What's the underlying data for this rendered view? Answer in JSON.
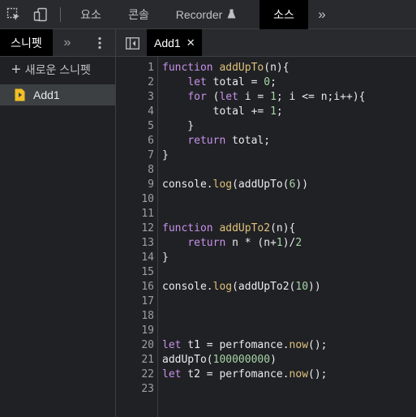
{
  "top_tabs": [
    {
      "label": "요소"
    },
    {
      "label": "콘솔"
    },
    {
      "label": "Recorder"
    },
    {
      "label": "소스"
    }
  ],
  "navigator": {
    "tab_label": "스니펫",
    "new_snippet_label": "새로운 스니펫",
    "snippets": [
      {
        "label": "Add1"
      }
    ]
  },
  "editor": {
    "open_file": "Add1",
    "lines": [
      "function addUpTo(n){",
      "    let total = 0;",
      "    for (let i = 1; i <= n;i++){",
      "        total += 1;",
      "    }",
      "    return total;",
      "}",
      "",
      "console.log(addUpTo(6))",
      "",
      "",
      "function addUpTo2(n){",
      "    return n * (n+1)/2",
      "}",
      "",
      "console.log(addUpTo2(10))",
      "",
      "",
      "",
      "let t1 = perfomance.now();",
      "addUpTo(100000000)",
      "let t2 = perfomance.now();",
      ""
    ]
  },
  "colors": {
    "keyword": "#c792ea",
    "function": "#dfc27d",
    "number": "#a5d6a7",
    "active_tab_bg": "#000000"
  }
}
